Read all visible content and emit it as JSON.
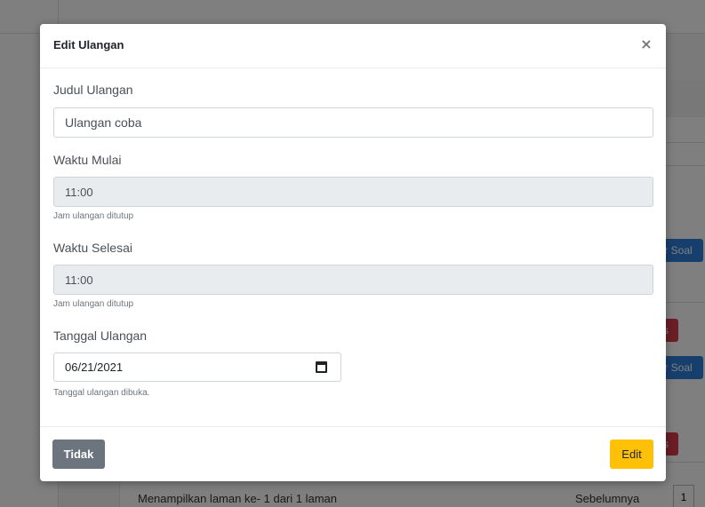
{
  "background": {
    "buttons": [
      {
        "label": "r Soal",
        "type": "blue"
      },
      {
        "label": "s",
        "type": "red"
      },
      {
        "label": "r Soal",
        "type": "blue"
      },
      {
        "label": "s",
        "type": "red"
      }
    ],
    "footer_text": "Menampilkan laman ke- 1 dari 1 laman",
    "prev_label": "Sebelumnya",
    "page_number": "1"
  },
  "modal": {
    "title": "Edit Ulangan",
    "close_icon": "×",
    "fields": {
      "judul": {
        "label": "Judul Ulangan",
        "value": "Ulangan coba"
      },
      "mulai": {
        "label": "Waktu Mulai",
        "value": "11:00",
        "help": "Jam ulangan ditutup"
      },
      "selesai": {
        "label": "Waktu Selesai",
        "value": "11:00",
        "help": "Jam ulangan ditutup"
      },
      "tanggal": {
        "label": "Tanggal Ulangan",
        "value": "06/21/2021",
        "help": "Tanggal ulangan dibuka.",
        "icon": "calendar-icon"
      }
    },
    "buttons": {
      "cancel": "Tidak",
      "submit": "Edit"
    }
  },
  "colors": {
    "overlay": "#000000",
    "cancel_button": "#6c757d",
    "submit_button": "#ffc107",
    "action_blue": "#2f7fdc",
    "action_red": "#d83a4a"
  }
}
